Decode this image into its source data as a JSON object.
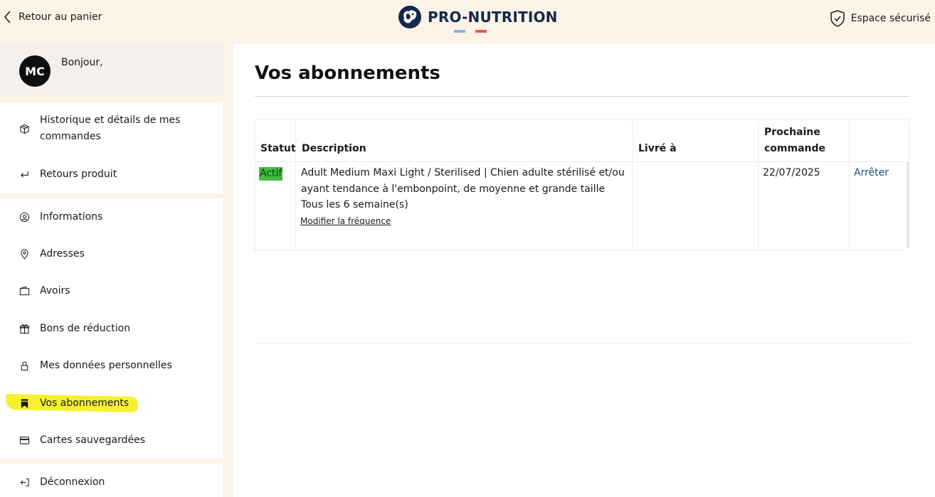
{
  "header": {
    "back_label": "Retour au panier",
    "brand": "PRO-NUTRITION",
    "secure_label": "Espace sécurisé",
    "flag_colors": [
      "#8fb0e0",
      "#e85c4a"
    ]
  },
  "sidebar": {
    "avatar_initials": "MC",
    "greeting": "Bonjour,",
    "items": [
      {
        "label": "Historique et détails de mes commandes",
        "icon": "box-icon"
      },
      {
        "label": "Retours produit",
        "icon": "return-arrow-icon"
      },
      {
        "label": "Informations",
        "icon": "user-circle-icon"
      },
      {
        "label": "Adresses",
        "icon": "location-pin-icon"
      },
      {
        "label": "Avoirs",
        "icon": "wallet-icon"
      },
      {
        "label": "Bons de réduction",
        "icon": "gift-icon"
      },
      {
        "label": "Mes données personnelles",
        "icon": "lock-icon"
      },
      {
        "label": "Vos abonnements",
        "icon": "bookmark-icon"
      },
      {
        "label": "Cartes sauvegardées",
        "icon": "credit-card-icon"
      },
      {
        "label": "Déconnexion",
        "icon": "logout-icon"
      }
    ]
  },
  "main": {
    "title": "Vos abonnements",
    "table": {
      "headers": [
        "Statut",
        "Description",
        "Livré à",
        "Prochaine commande",
        ""
      ],
      "rows": [
        {
          "status": "Actif",
          "description_line1": "Adult Medium Maxi Light / Sterilised | Chien adulte stérilisé et/ou",
          "description_line2": "ayant tendance à l'embonpoint, de moyenne et grande taille",
          "frequency": "Tous les 6 semaine(s)",
          "modify_link": "Modifier la fréquence",
          "delivered_to": "",
          "next_order": "22/07/2025",
          "action": "Arrêter"
        }
      ]
    }
  },
  "colors": {
    "page_background": "#fdf3e7",
    "status_active": "#3fbf3f",
    "link_blue": "#214b80",
    "brand_navy": "#14294b",
    "annotation_highlight": "#f5f01a"
  }
}
